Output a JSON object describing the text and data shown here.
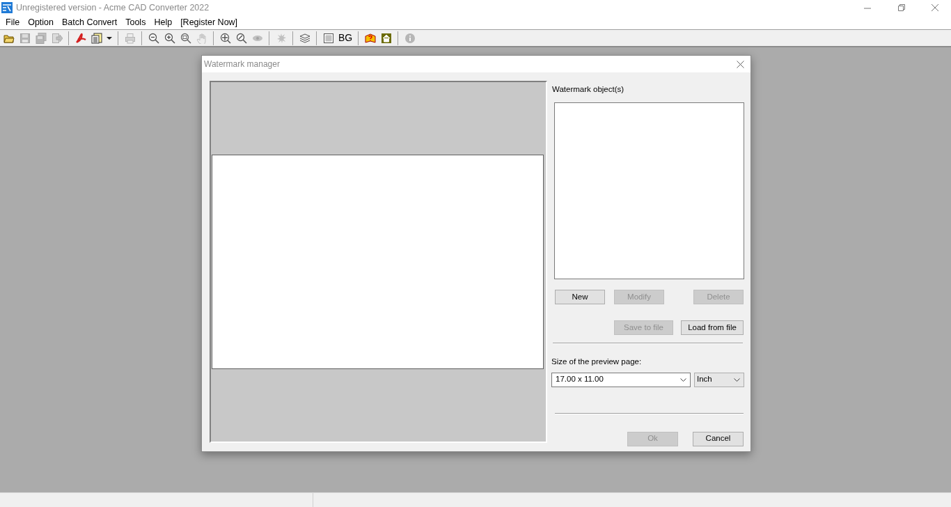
{
  "window": {
    "title": "Unregistered version - Acme CAD Converter 2022"
  },
  "menu": [
    "File",
    "Option",
    "Batch Convert",
    "Tools",
    "Help",
    "[Register Now]"
  ],
  "toolbar": [
    {
      "kind": "folder",
      "disabled": false
    },
    {
      "kind": "disk",
      "disabled": true
    },
    {
      "kind": "disks",
      "disabled": true
    },
    {
      "kind": "export",
      "disabled": true
    },
    {
      "kind": "separator"
    },
    {
      "kind": "pdf",
      "disabled": false
    },
    {
      "kind": "document",
      "disabled": false
    },
    {
      "kind": "dropdown",
      "disabled": false
    },
    {
      "kind": "separator"
    },
    {
      "kind": "printer",
      "disabled": true
    },
    {
      "kind": "separator"
    },
    {
      "kind": "zoom-out",
      "disabled": false
    },
    {
      "kind": "zoom-in",
      "disabled": false
    },
    {
      "kind": "zoom-window",
      "disabled": false
    },
    {
      "kind": "hand",
      "disabled": true
    },
    {
      "kind": "separator"
    },
    {
      "kind": "zoom-extents",
      "disabled": false
    },
    {
      "kind": "zoom-realtime",
      "disabled": false
    },
    {
      "kind": "eye",
      "disabled": true
    },
    {
      "kind": "separator"
    },
    {
      "kind": "burst",
      "disabled": true
    },
    {
      "kind": "separator"
    },
    {
      "kind": "layers",
      "disabled": false
    },
    {
      "kind": "separator"
    },
    {
      "kind": "grid",
      "disabled": false
    },
    {
      "kind": "text",
      "label": "BG",
      "disabled": false
    },
    {
      "kind": "separator"
    },
    {
      "kind": "help",
      "disabled": false
    },
    {
      "kind": "home",
      "disabled": false
    },
    {
      "kind": "separator"
    },
    {
      "kind": "info",
      "disabled": true
    }
  ],
  "dialog": {
    "title": "Watermark manager",
    "objects_label": "Watermark object(s)",
    "buttons_row1": [
      {
        "label": "New",
        "disabled": false
      },
      {
        "label": "Modify",
        "disabled": true
      },
      {
        "label": "Delete",
        "disabled": true
      }
    ],
    "buttons_row2": [
      {
        "label": "Save to file",
        "disabled": true
      },
      {
        "label": "Load from file",
        "disabled": false
      }
    ],
    "size_label": "Size of the preview page:",
    "size_value": "17.00 x 11.00",
    "unit_value": "Inch",
    "footer_buttons": [
      {
        "label": "Ok",
        "disabled": true
      },
      {
        "label": "Cancel",
        "disabled": false
      }
    ]
  }
}
